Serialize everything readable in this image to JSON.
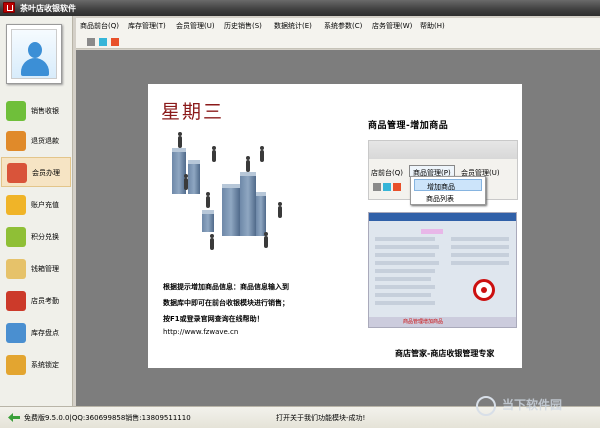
{
  "window": {
    "title": "茶叶店收银软件"
  },
  "sidebar": {
    "items": [
      {
        "label": "销售收银",
        "icon": "sale-tag-icon",
        "color": "#6fbf3a"
      },
      {
        "label": "退货退款",
        "icon": "return-box-icon",
        "color": "#e08a2a"
      },
      {
        "label": "会员办理",
        "icon": "member-card-icon",
        "color": "#d9543a",
        "active": true
      },
      {
        "label": "账户充值",
        "icon": "credit-card-icon",
        "color": "#f0b428"
      },
      {
        "label": "积分兑换",
        "icon": "pencil-icon",
        "color": "#8fbf36"
      },
      {
        "label": "钱箱管理",
        "icon": "cash-drawer-icon",
        "color": "#e6c26a"
      },
      {
        "label": "店员考勤",
        "icon": "staff-people-icon",
        "color": "#cc3a2a"
      },
      {
        "label": "库存盘点",
        "icon": "inventory-icon",
        "color": "#4a8fd0"
      },
      {
        "label": "系统锁定",
        "icon": "lock-icon",
        "color": "#e3a530"
      }
    ]
  },
  "menubar": {
    "items": [
      "商品前台(Q)",
      "库存管理(T)",
      "会员管理(U)",
      "历史销售(S)",
      "数据统计(E)",
      "系统参数(C)",
      "店务管理(W)",
      "帮助(H)"
    ]
  },
  "colors": {
    "swatches": [
      "#8a8a8a",
      "#36b5d8",
      "#e8502a"
    ]
  },
  "document": {
    "day": "星期三",
    "section_title": "商品管理-增加商品",
    "inset_menu": [
      "店前台(Q)",
      "商品管理(P)",
      "会员管理(U)"
    ],
    "dropdown_items": [
      "增加商品",
      "商品列表"
    ],
    "inset_footer": "商品管理增加商品",
    "caption_lines": [
      "根据提示增加商品信息：商品信息输入到",
      "数据库中即可在前台收银模块进行销售；",
      "按F1或登录官网查询在线帮助！"
    ],
    "website": "http://www.fzwave.cn",
    "slogan": "商店管家-商店收银管理专家"
  },
  "statusbar": {
    "left": "免费版9.5.0.0|QQ:360699858销售:13809511110",
    "center": "打开关于我们功能模块-成功!"
  },
  "watermark": "当下软件园"
}
